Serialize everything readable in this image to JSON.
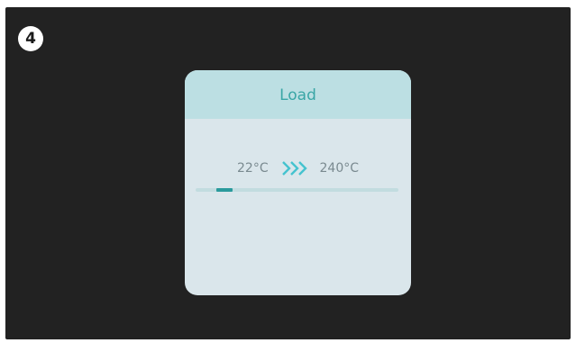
{
  "step_badge": "4",
  "dialog": {
    "title": "Load",
    "current_temp": "22°C",
    "target_temp": "240°C",
    "progress_fraction": 0.08
  },
  "colors": {
    "background": "#222222",
    "dialog_body": "#dae6eb",
    "dialog_header": "#bcdfe3",
    "accent": "#2a9a9c",
    "title_text": "#3aa6a6"
  },
  "icons": {
    "step": "step-number-icon",
    "heating_arrows": "triple-chevron-right-icon"
  }
}
